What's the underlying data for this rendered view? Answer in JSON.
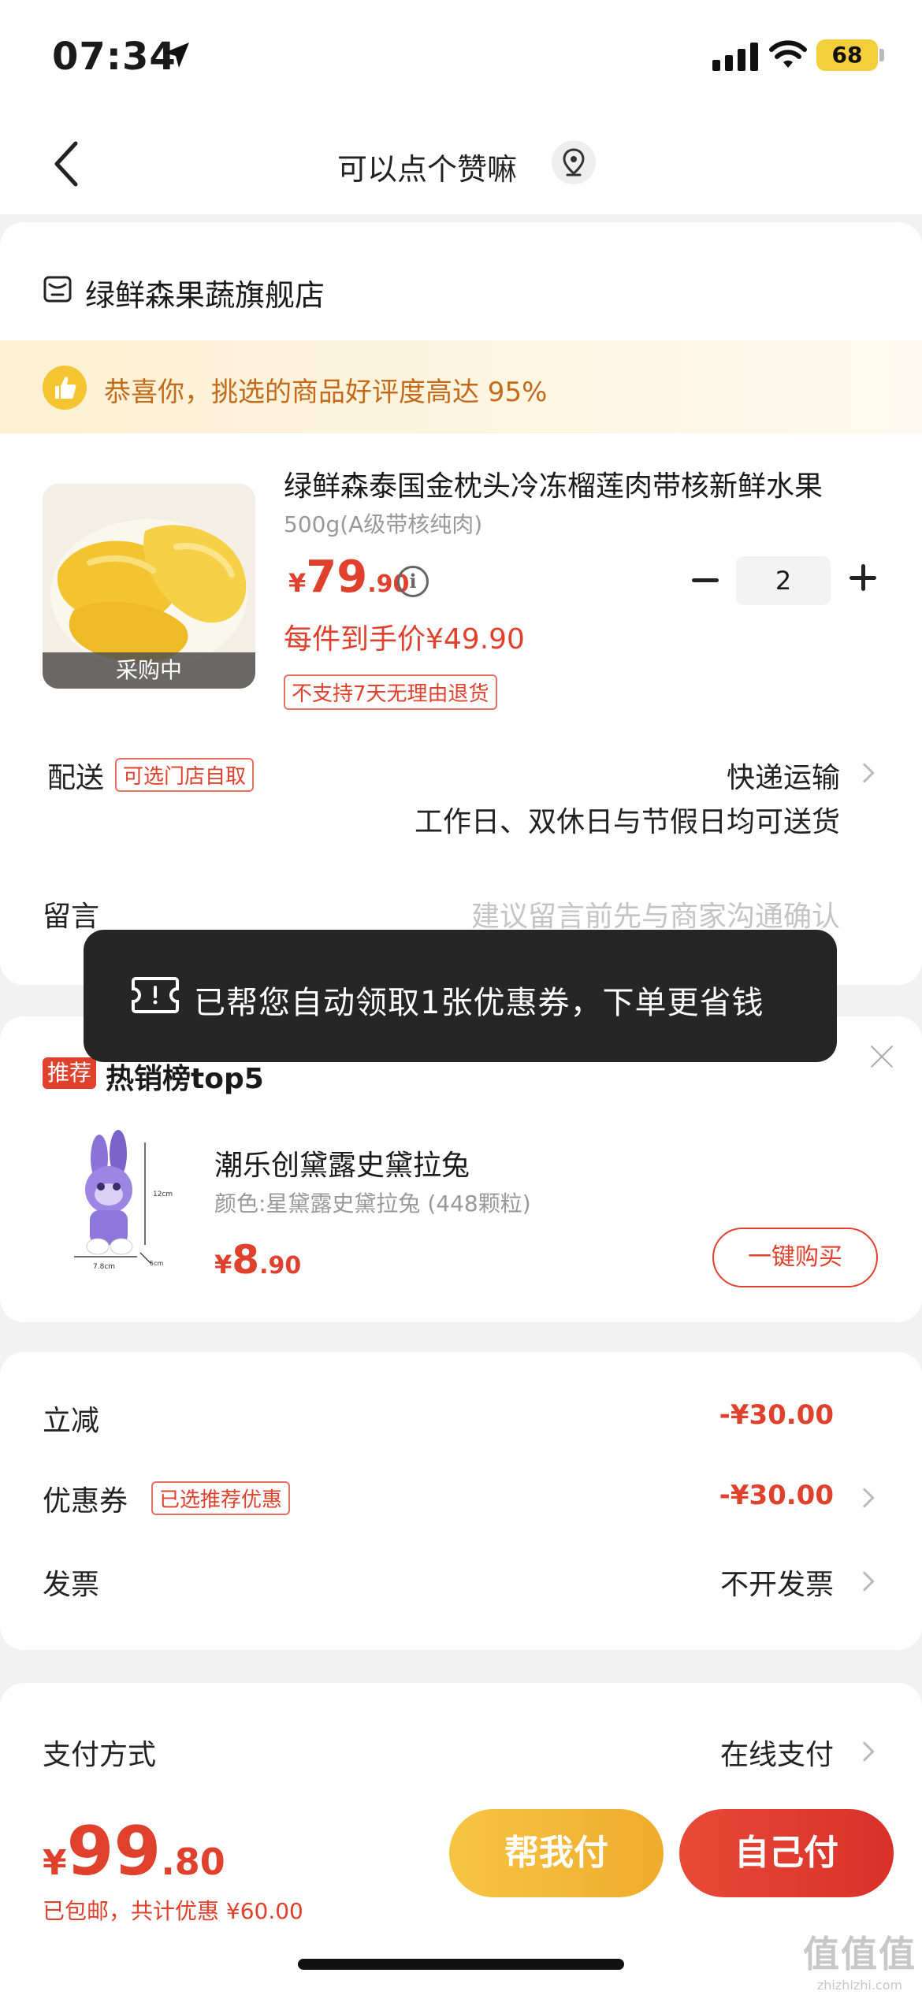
{
  "status": {
    "time": "07:34",
    "battery": "68"
  },
  "nav": {
    "title": "可以点个赞嘛"
  },
  "shop": {
    "name": "绿鲜森果蔬旗舰店"
  },
  "praise": {
    "text": "恭喜你，挑选的商品好评度高达 95%"
  },
  "product": {
    "title": "绿鲜森泰国金枕头冷冻榴莲肉带核新鲜水果",
    "spec": "500g(A级带核纯肉)",
    "price_symbol": "¥",
    "price_int": "79",
    "price_dec": ".90",
    "unit_price": "每件到手价¥49.90",
    "tag": "不支持7天无理由退货",
    "badge": "采购中",
    "quantity": "2"
  },
  "delivery": {
    "label": "配送",
    "chip": "可选门店自取",
    "method": "快递运输",
    "note": "工作日、双休日与节假日均可送货"
  },
  "message": {
    "label": "留言",
    "placeholder": "建议留言前先与商家沟通确认"
  },
  "toast": {
    "text": "已帮您自动领取1张优惠券，下单更省钱"
  },
  "recommend": {
    "badge": "推荐",
    "title": "热销榜top5",
    "item_name": "潮乐创黛露史黛拉兔",
    "item_spec": "颜色:星黛露史黛拉兔 (448颗粒)",
    "price_symbol": "¥",
    "price_int": "8",
    "price_dec": ".90",
    "button": "一键购买",
    "dims": {
      "h": "12cm",
      "w": "7.8cm",
      "d": "5cm"
    }
  },
  "discounts": {
    "instant_label": "立减",
    "instant_value": "-¥30.00",
    "coupon_label": "优惠券",
    "coupon_chip": "已选推荐优惠",
    "coupon_value": "-¥30.00",
    "invoice_label": "发票",
    "invoice_value": "不开发票"
  },
  "payment": {
    "label": "支付方式",
    "value": "在线支付"
  },
  "footer": {
    "price_symbol": "¥",
    "total_int": "99",
    "total_dec": ".80",
    "sub": "已包邮，共计优惠 ¥60.00",
    "help_button": "帮我付",
    "self_button": "自己付"
  },
  "watermark": {
    "logo": "值值值",
    "site": "zhizhizhi.com"
  },
  "colors": {
    "accent": "#e0412c",
    "gold": "#f5c531",
    "toast_bg": "#262626"
  }
}
